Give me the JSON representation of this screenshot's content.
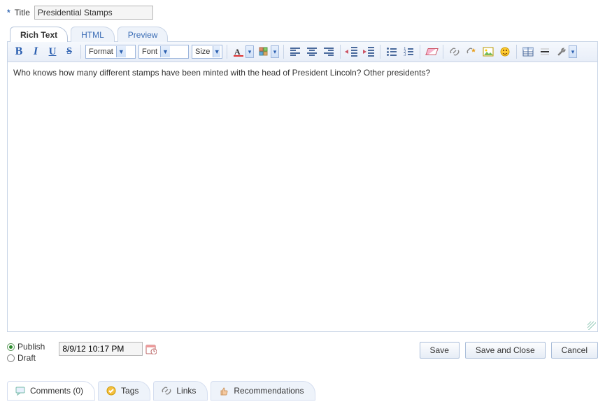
{
  "title": {
    "label": "Title",
    "value": "Presidential Stamps"
  },
  "tabs": {
    "rich_text": "Rich Text",
    "html": "HTML",
    "preview": "Preview"
  },
  "toolbar": {
    "format_label": "Format",
    "font_label": "Font",
    "size_label": "Size"
  },
  "content": "Who knows how many different stamps have been minted with the head of President Lincoln?  Other presidents?",
  "publish": {
    "publish_label": "Publish",
    "draft_label": "Draft",
    "date_value": "8/9/12 10:17 PM"
  },
  "buttons": {
    "save": "Save",
    "save_close": "Save and Close",
    "cancel": "Cancel"
  },
  "bottom_tabs": {
    "comments": "Comments (0)",
    "tags": "Tags",
    "links": "Links",
    "recommendations": "Recommendations"
  }
}
